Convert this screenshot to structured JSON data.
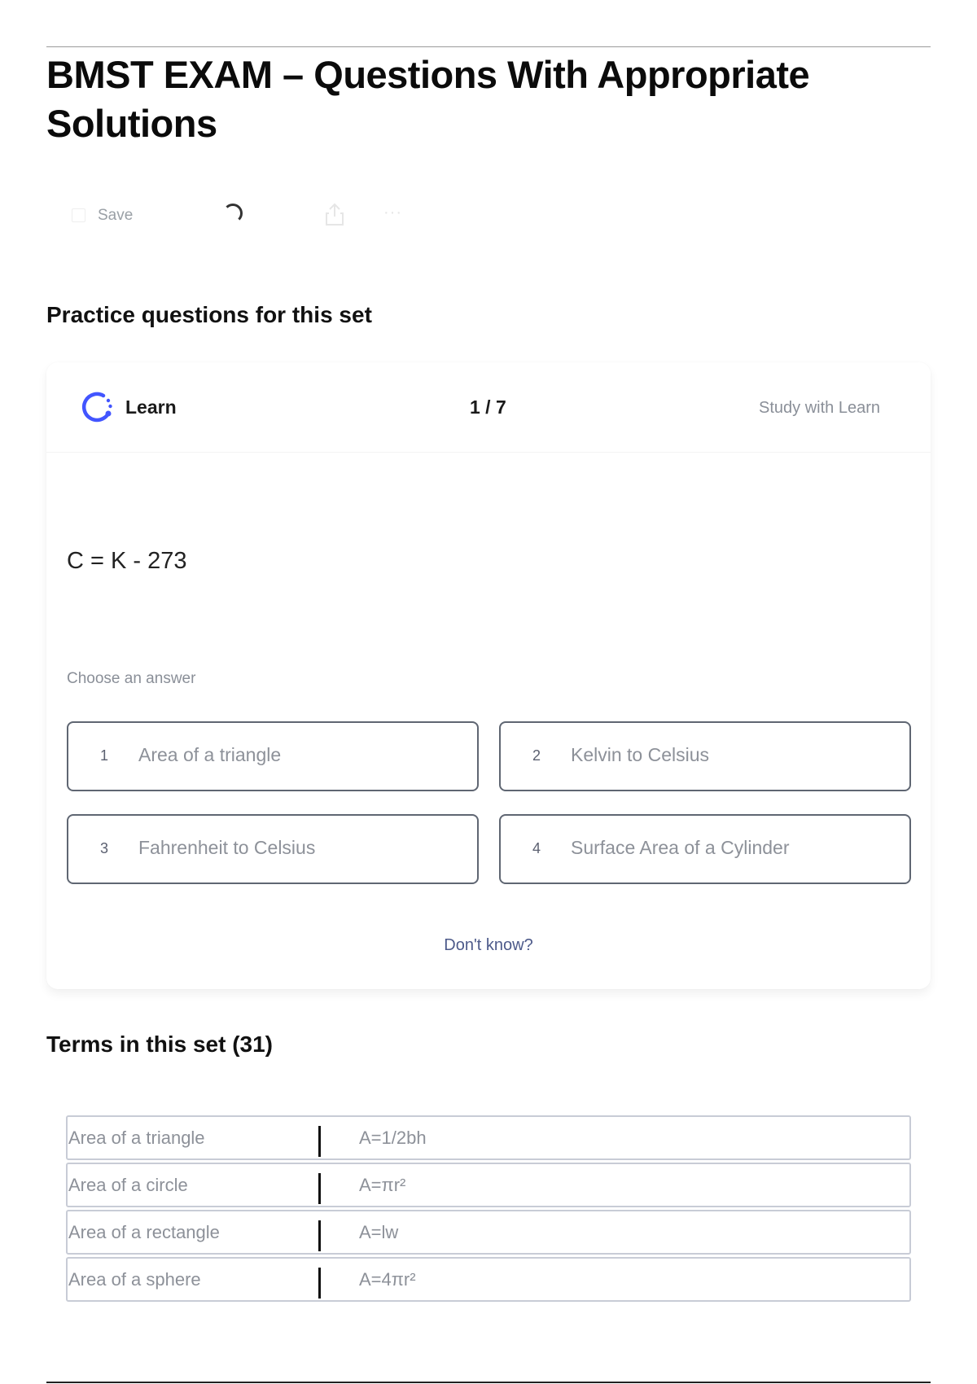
{
  "page": {
    "title": "BMST EXAM – Questions With Appropriate Solutions"
  },
  "toolbar": {
    "save_label": "Save",
    "more_label": "···"
  },
  "practice": {
    "heading": "Practice questions for this set",
    "learn_label": "Learn",
    "progress": "1 / 7",
    "study_link": "Study with Learn",
    "prompt": "C = K - 273",
    "choose_label": "Choose an answer",
    "options": [
      {
        "num": "1",
        "text": "Area of a triangle"
      },
      {
        "num": "2",
        "text": "Kelvin to Celsius"
      },
      {
        "num": "3",
        "text": "Fahrenheit to Celsius"
      },
      {
        "num": "4",
        "text": "Surface Area of a Cylinder"
      }
    ],
    "dont_know": "Don't know?"
  },
  "terms": {
    "heading": "Terms in this set (31)",
    "rows": [
      {
        "term": "Area of a triangle",
        "definition": "A=1/2bh"
      },
      {
        "term": "Area of a circle",
        "definition": "A=πr²"
      },
      {
        "term": "Area of a rectangle",
        "definition": "A=lw"
      },
      {
        "term": "Area of a sphere",
        "definition": "A=4πr²"
      }
    ]
  },
  "colors": {
    "accent": "#4255ff",
    "option_border": "#5f6672",
    "link": "#4d5a8a"
  },
  "icons": {
    "learn": "learn-progress-icon",
    "share": "share-icon",
    "more": "more-icon",
    "loading": "spinner-icon"
  }
}
